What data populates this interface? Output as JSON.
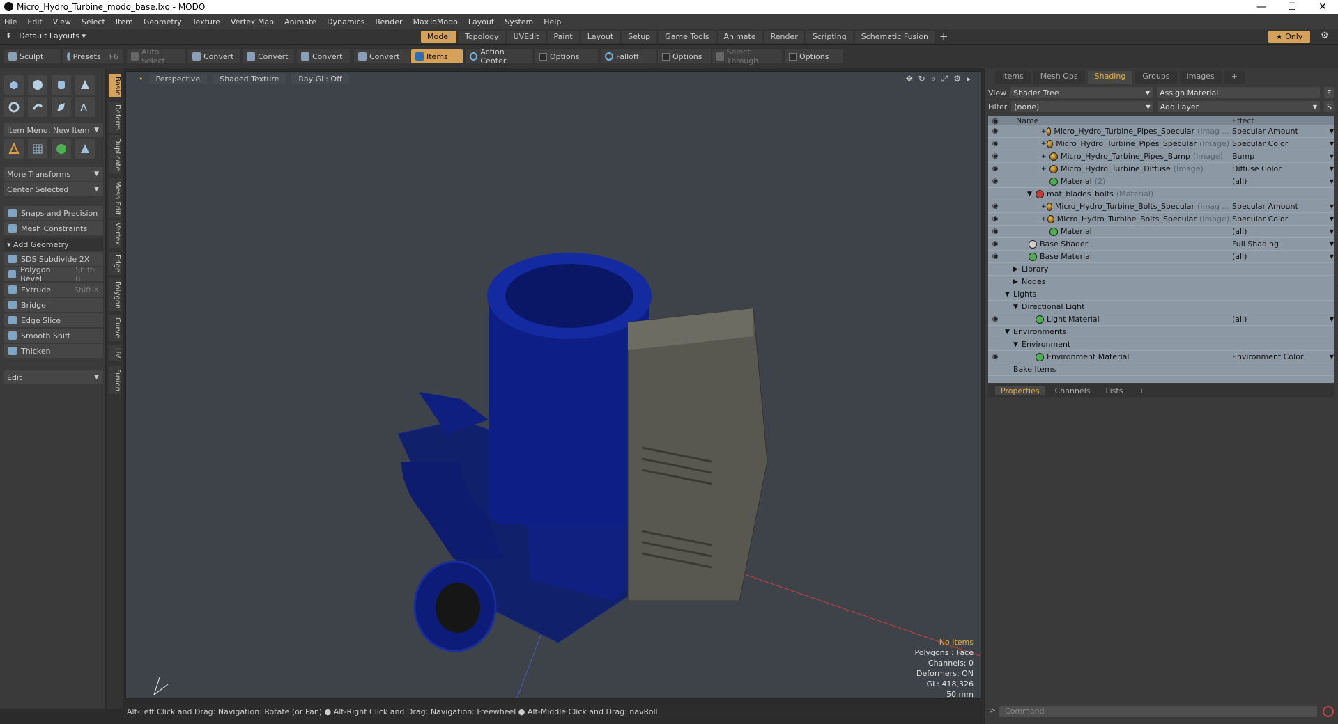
{
  "window": {
    "title": "Micro_Hydro_Turbine_modo_base.lxo - MODO",
    "controls": [
      "—",
      "☐",
      "✕"
    ]
  },
  "menu": [
    "File",
    "Edit",
    "View",
    "Select",
    "Item",
    "Geometry",
    "Texture",
    "Vertex Map",
    "Animate",
    "Dynamics",
    "Render",
    "MaxToModo",
    "Layout",
    "System",
    "Help"
  ],
  "layout": {
    "selector": "Default Layouts ▾",
    "tabs": [
      "Model",
      "Topology",
      "UVEdit",
      "Paint",
      "Layout",
      "Setup",
      "Game Tools",
      "Animate",
      "Render",
      "Scripting",
      "Schematic Fusion"
    ],
    "active_tab": "Model",
    "plus": "+",
    "only": "★ Only",
    "gear": "⚙"
  },
  "toolbar": {
    "sculpt": "Sculpt",
    "presets": "Presets",
    "presets_key": "F6",
    "auto_select": "Auto Select",
    "convert1": "Convert",
    "convert2": "Convert",
    "convert3": "Convert",
    "convert4": "Convert",
    "items": "Items",
    "action_center": "Action Center",
    "options1": "Options",
    "falloff": "Falloff",
    "options2": "Options",
    "select_through": "Select Through",
    "options3": "Options"
  },
  "left": {
    "item_menu": "Item Menu: New Item",
    "more_transforms": "More Transforms",
    "center_selected": "Center Selected",
    "snaps": "Snaps and Precision",
    "mesh_constraints": "Mesh Constraints",
    "add_geometry": "Add Geometry",
    "tools": [
      {
        "label": "SDS Subdivide 2X",
        "key": ""
      },
      {
        "label": "Polygon Bevel",
        "key": "Shift-B"
      },
      {
        "label": "Extrude",
        "key": "Shift-X"
      },
      {
        "label": "Bridge",
        "key": ""
      },
      {
        "label": "Edge Slice",
        "key": ""
      },
      {
        "label": "Smooth Shift",
        "key": ""
      },
      {
        "label": "Thicken",
        "key": ""
      }
    ],
    "edit": "Edit"
  },
  "vtabs": [
    "Basic",
    "Deform",
    "Duplicate",
    "Mesh Edit",
    "Vertex",
    "Edge",
    "Polygon",
    "Curve",
    "UV",
    "Fusion"
  ],
  "viewport": {
    "perspective": "Perspective",
    "shaded": "Shaded Texture",
    "raygl": "Ray GL: Off",
    "info": [
      "No Items",
      "Polygons : Face",
      "Channels: 0",
      "Deformers: ON",
      "GL: 418,326",
      "50 mm"
    ]
  },
  "status": "Alt-Left Click and Drag: Navigation: Rotate (or Pan) ● Alt-Right Click and Drag: Navigation: Freewheel ● Alt-Middle Click and Drag: navRoll",
  "right": {
    "tabs": [
      "Items",
      "Mesh Ops",
      "Shading",
      "Groups",
      "Images",
      "+"
    ],
    "active_tab": "Shading",
    "view_label": "View",
    "view_value": "Shader Tree",
    "assign_material": "Assign Material",
    "filter_label": "Filter",
    "filter_value": "(none)",
    "add_layer": "Add Layer",
    "btn_f": "F",
    "btn_s": "S",
    "col_name": "Name",
    "col_effect": "Effect",
    "tree": [
      {
        "indent": 56,
        "exp": "+",
        "icon": "img",
        "name": "Micro_Hydro_Turbine_Pipes_Specular",
        "type": "(Imag ...",
        "effect": "Specular Amount"
      },
      {
        "indent": 56,
        "exp": "+",
        "icon": "img",
        "name": "Micro_Hydro_Turbine_Pipes_Specular",
        "type": "(Image)",
        "effect": "Specular Color"
      },
      {
        "indent": 56,
        "exp": "+",
        "icon": "img",
        "name": "Micro_Hydro_Turbine_Pipes_Bump",
        "type": "(Image)",
        "effect": "Bump"
      },
      {
        "indent": 56,
        "exp": "+",
        "icon": "img",
        "name": "Micro_Hydro_Turbine_Diffuse",
        "type": "(Image)",
        "effect": "Diffuse Color"
      },
      {
        "indent": 56,
        "exp": "",
        "icon": "mat",
        "name": "Material",
        "type": "(2)",
        "effect": "(all)"
      },
      {
        "indent": 36,
        "exp": "▼",
        "icon": "red",
        "name": "mat_blades_bolts",
        "type": "(Material)",
        "effect": ""
      },
      {
        "indent": 56,
        "exp": "+",
        "icon": "img",
        "name": "Micro_Hydro_Turbine_Bolts_Specular",
        "type": "(Imag ...",
        "effect": "Specular Amount"
      },
      {
        "indent": 56,
        "exp": "+",
        "icon": "img",
        "name": "Micro_Hydro_Turbine_Bolts_Specular",
        "type": "(Image)",
        "effect": "Specular Color"
      },
      {
        "indent": 56,
        "exp": "",
        "icon": "mat",
        "name": "Material",
        "type": "",
        "effect": "(all)"
      },
      {
        "indent": 26,
        "exp": "",
        "icon": "base",
        "name": "Base Shader",
        "type": "",
        "effect": "Full Shading"
      },
      {
        "indent": 26,
        "exp": "",
        "icon": "mat",
        "name": "Base Material",
        "type": "",
        "effect": "(all)"
      },
      {
        "indent": 16,
        "exp": "▶",
        "icon": "",
        "name": "Library",
        "type": "",
        "effect": ""
      },
      {
        "indent": 16,
        "exp": "▶",
        "icon": "",
        "name": "Nodes",
        "type": "",
        "effect": ""
      },
      {
        "indent": 4,
        "exp": "▼",
        "icon": "",
        "name": "Lights",
        "type": "",
        "effect": ""
      },
      {
        "indent": 16,
        "exp": "▼",
        "icon": "",
        "name": "Directional Light",
        "type": "",
        "effect": ""
      },
      {
        "indent": 36,
        "exp": "",
        "icon": "mat",
        "name": "Light Material",
        "type": "",
        "effect": "(all)"
      },
      {
        "indent": 4,
        "exp": "▼",
        "icon": "",
        "name": "Environments",
        "type": "",
        "effect": ""
      },
      {
        "indent": 16,
        "exp": "▼",
        "icon": "",
        "name": "Environment",
        "type": "",
        "effect": ""
      },
      {
        "indent": 36,
        "exp": "",
        "icon": "mat",
        "name": "Environment Material",
        "type": "",
        "effect": "Environment Color"
      },
      {
        "indent": 4,
        "exp": "",
        "icon": "",
        "name": "Bake Items",
        "type": "",
        "effect": ""
      }
    ],
    "props_tabs": [
      "Properties",
      "Channels",
      "Lists",
      "+"
    ],
    "command_placeholder": "Command"
  }
}
